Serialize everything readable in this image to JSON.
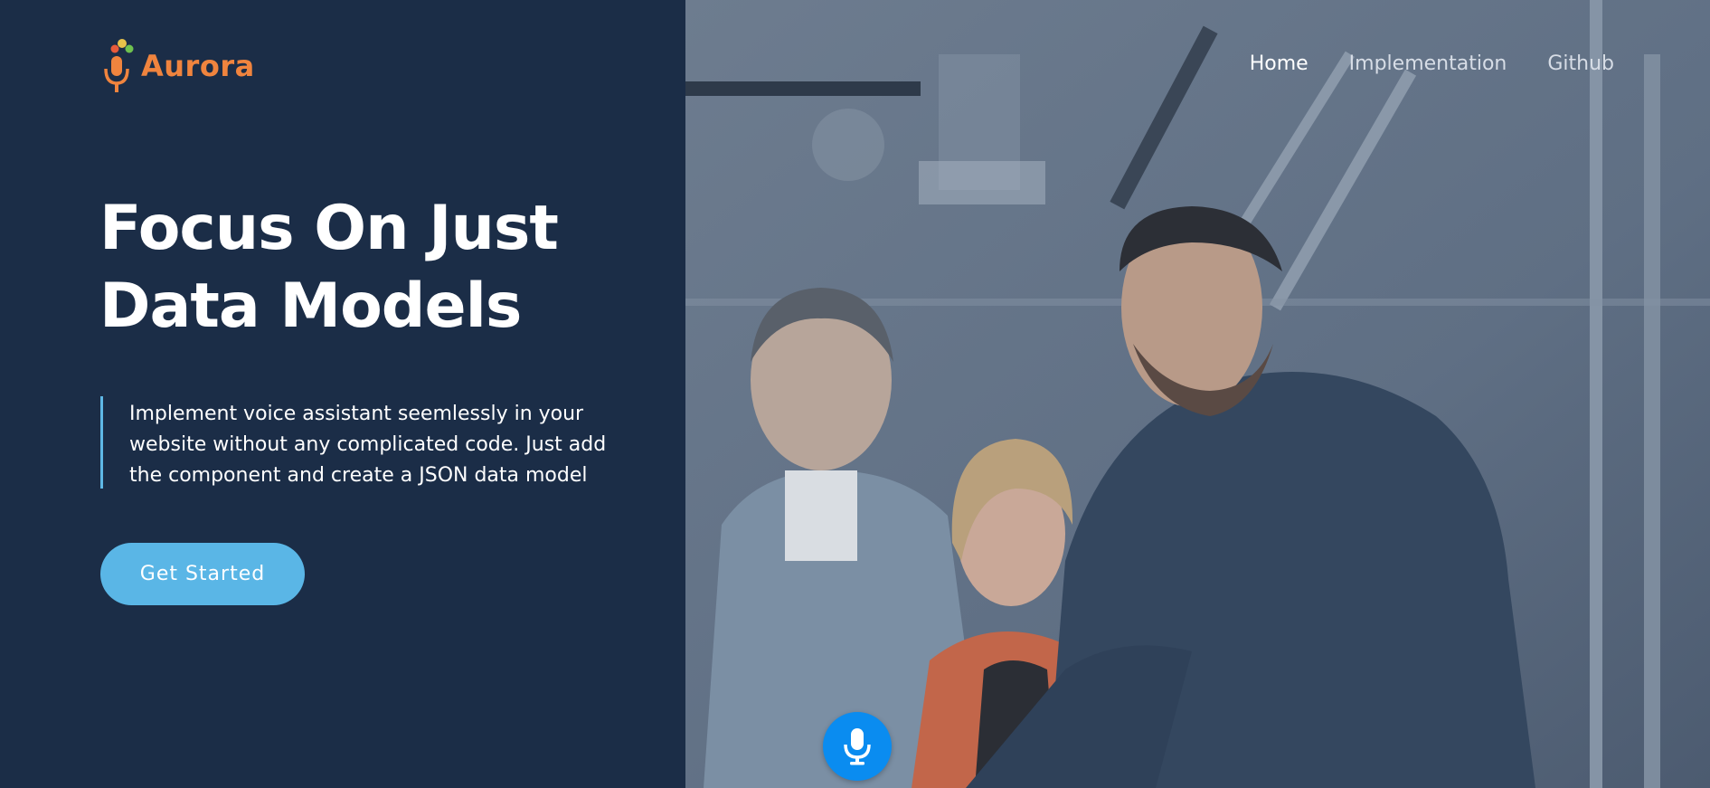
{
  "brand": {
    "name": "Aurora",
    "logo_icon": "microphone-logo-icon",
    "color": "#f0843e"
  },
  "hero": {
    "title_line1": "Focus On Just",
    "title_line2": "Data Models",
    "description": "Implement voice assistant seemlessly in your website without any complicated code. Just add the component and create a JSON data model",
    "cta_label": "Get Started"
  },
  "nav": {
    "items": [
      {
        "label": "Home",
        "active": true
      },
      {
        "label": "Implementation",
        "active": false
      },
      {
        "label": "Github",
        "active": false
      }
    ]
  },
  "voice_button": {
    "icon": "microphone-icon",
    "color": "#0a8cf0"
  },
  "colors": {
    "panel_bg": "#1b2d47",
    "accent": "#5ab6e6"
  }
}
